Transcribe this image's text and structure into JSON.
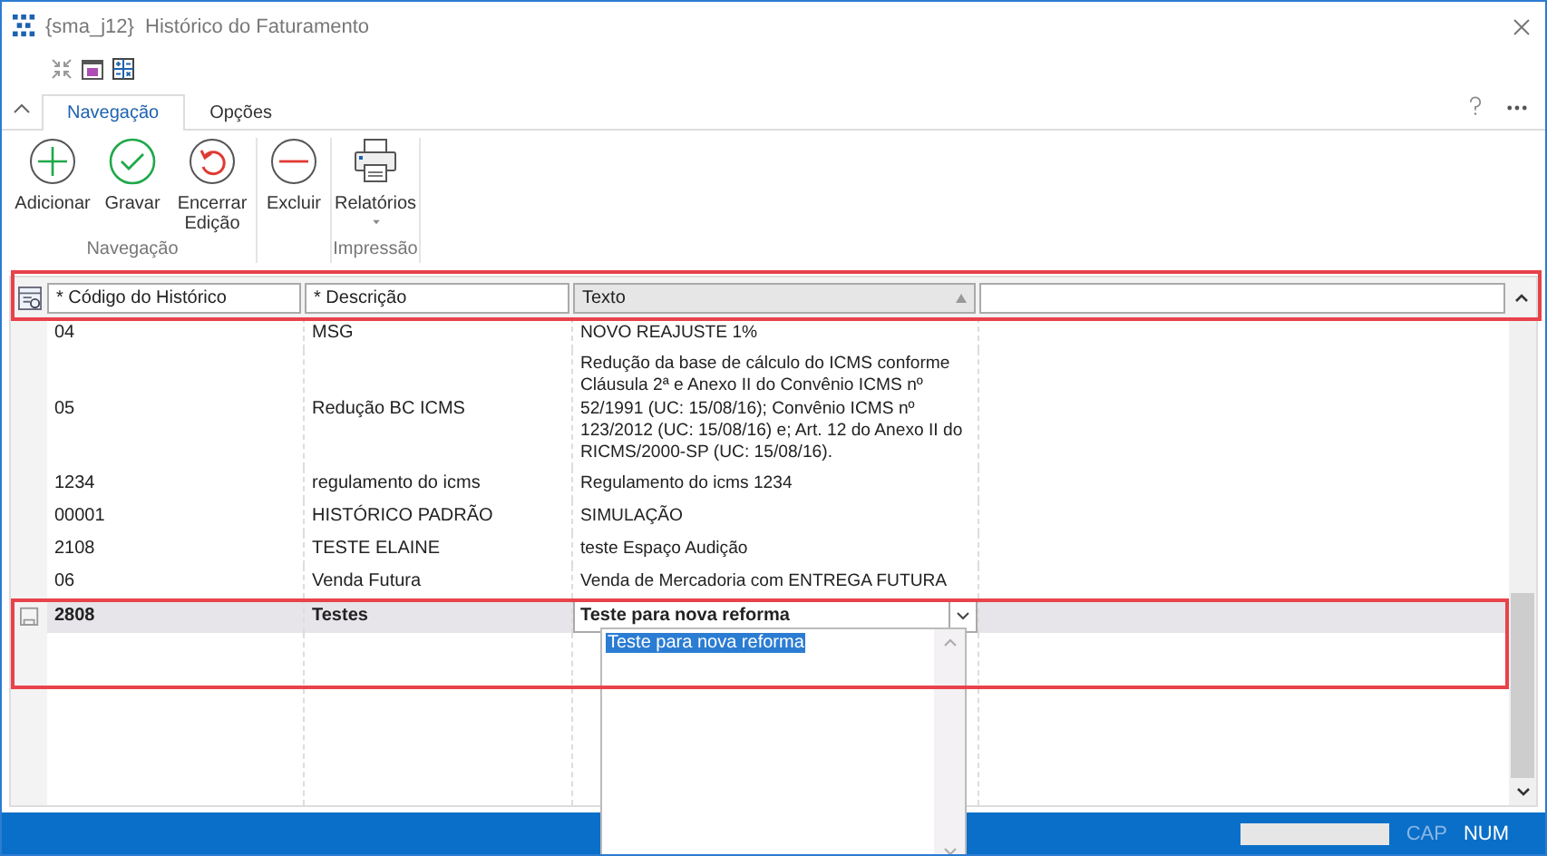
{
  "window": {
    "title": "{sma_j12}  Histórico do Faturamento"
  },
  "quick_access": [
    {
      "kind": "collapse"
    },
    {
      "kind": "calendar"
    },
    {
      "kind": "calculator"
    }
  ],
  "tabs": [
    {
      "label": "Navegação",
      "selected": true
    },
    {
      "label": "Opções",
      "selected": false
    }
  ],
  "ribbon_groups": [
    {
      "label": "Navegação",
      "buttons": [
        {
          "label": "Adicionar",
          "kind": "add"
        },
        {
          "label": "Gravar",
          "kind": "save"
        },
        {
          "label": "Encerrar Edição",
          "kind": "undo"
        }
      ]
    },
    {
      "buttons": [
        {
          "label": "Excluir",
          "kind": "delete"
        }
      ]
    },
    {
      "label": "Impressão",
      "buttons": [
        {
          "label": "Relatórios",
          "kind": "print",
          "dropdown": true
        }
      ]
    }
  ],
  "table": {
    "columns": [
      {
        "label": "* Código do Histórico"
      },
      {
        "label": "* Descrição"
      },
      {
        "label": "Texto",
        "sorted": true
      }
    ],
    "rows": [
      {
        "cells": [
          "04",
          "MSG",
          "NOVO REAJUSTE 1%"
        ],
        "selected": false
      },
      {
        "cells": [
          "05",
          "Redução BC ICMS",
          "Redução da base de cálculo do ICMS conforme Cláusula 2ª e Anexo II do Convênio ICMS nº 52/1991 (UC: 15/08/16); Convênio ICMS nº 123/2012 (UC: 15/08/16) e; Art. 12 do Anexo II do RICMS/2000-SP (UC: 15/08/16)."
        ],
        "selected": false
      },
      {
        "cells": [
          "1234",
          "regulamento do icms",
          "Regulamento do icms 1234"
        ],
        "selected": false
      },
      {
        "cells": [
          "00001",
          "HISTÓRICO PADRÃO",
          "SIMULAÇÃO"
        ],
        "selected": false
      },
      {
        "cells": [
          "2108",
          "TESTE ELAINE",
          "teste Espaço Audição"
        ],
        "selected": false
      },
      {
        "cells": [
          "06",
          "Venda Futura",
          "Venda de Mercadoria com ENTREGA FUTURA"
        ],
        "selected": false
      },
      {
        "cells": [
          "2808",
          "Testes",
          "Teste para nova reforma"
        ],
        "selected": true
      }
    ],
    "dropdown_options": [
      {
        "label": "Teste para nova reforma",
        "selected": true
      }
    ]
  },
  "status_bar": {
    "indicators": [
      {
        "label": "CAP",
        "on": false
      },
      {
        "label": "NUM",
        "on": true
      }
    ]
  }
}
